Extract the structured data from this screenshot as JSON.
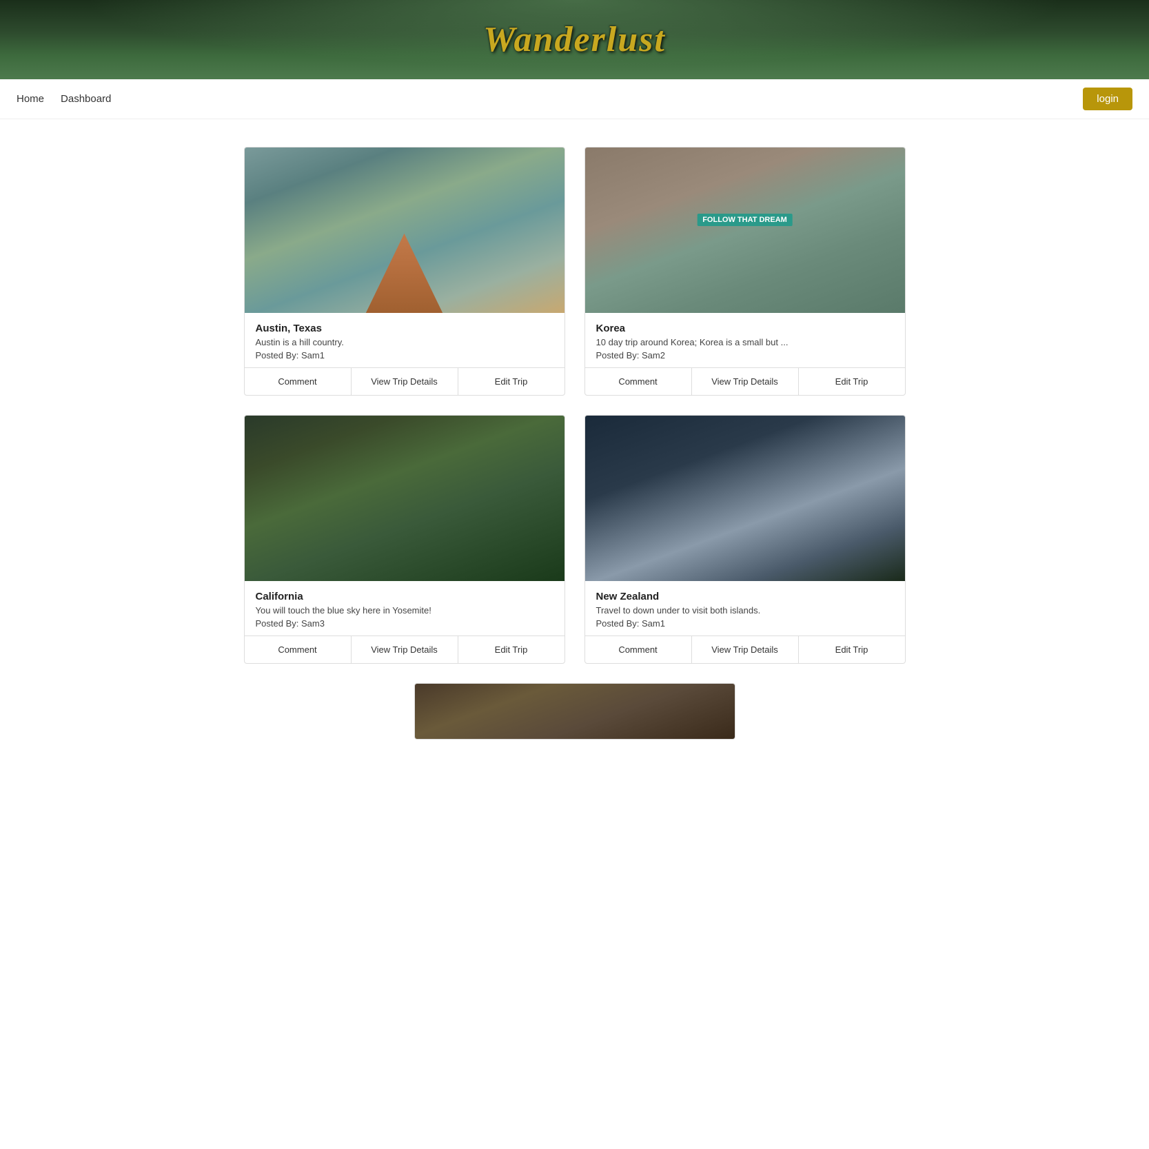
{
  "hero": {
    "title": "Wanderlust"
  },
  "navbar": {
    "home_label": "Home",
    "dashboard_label": "Dashboard",
    "login_label": "login"
  },
  "trips": [
    {
      "id": "austin",
      "title": "Austin, Texas",
      "description": "Austin is a hill country.",
      "posted_by": "Posted By: Sam1",
      "image_class": "img-austin",
      "comment_label": "Comment",
      "view_label": "View Trip Details",
      "edit_label": "Edit Trip"
    },
    {
      "id": "korea",
      "title": "Korea",
      "description": "10 day trip around Korea; Korea is a small but ...",
      "posted_by": "Posted By: Sam2",
      "image_class": "img-korea",
      "comment_label": "Comment",
      "view_label": "View Trip Details",
      "edit_label": "Edit Trip"
    },
    {
      "id": "california",
      "title": "California",
      "description": "You will touch the blue sky here in Yosemite!",
      "posted_by": "Posted By: Sam3",
      "image_class": "img-california",
      "comment_label": "Comment",
      "view_label": "View Trip Details",
      "edit_label": "Edit Trip"
    },
    {
      "id": "newzealand",
      "title": "New Zealand",
      "description": "Travel to down under to visit both islands.",
      "posted_by": "Posted By: Sam1",
      "image_class": "img-newzealand",
      "comment_label": "Comment",
      "view_label": "View Trip Details",
      "edit_label": "Edit Trip"
    }
  ],
  "bottom_card": {
    "image_class": "img-bottom"
  }
}
